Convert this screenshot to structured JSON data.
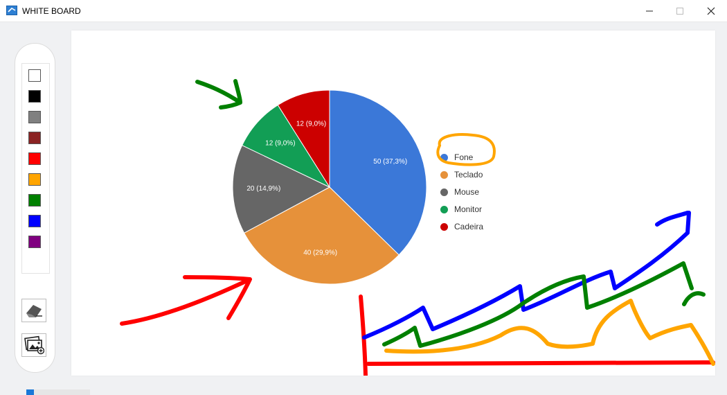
{
  "window": {
    "title": "WHITE BOARD",
    "buttons": {
      "minimize": "—",
      "maximize": "☐",
      "close": "✕"
    }
  },
  "palette": {
    "colors": [
      "#ffffff",
      "#000000",
      "#808080",
      "#8b2323",
      "#ff0000",
      "#ffa500",
      "#008000",
      "#0000ff",
      "#800080"
    ],
    "tools": [
      {
        "name": "eraser",
        "icon": "eraser-icon"
      },
      {
        "name": "insert-image",
        "icon": "image-add-icon"
      }
    ]
  },
  "chart_data": {
    "type": "pie",
    "title": "",
    "series": [
      {
        "label": "Fone",
        "value": 50,
        "percent": "37,3%",
        "color": "#3b78d8"
      },
      {
        "label": "Teclado",
        "value": 40,
        "percent": "29,9%",
        "color": "#e6913a"
      },
      {
        "label": "Mouse",
        "value": 20,
        "percent": "14,9%",
        "color": "#666666"
      },
      {
        "label": "Monitor",
        "value": 12,
        "percent": "9,0%",
        "color": "#129e55"
      },
      {
        "label": "Cadeira",
        "value": 12,
        "percent": "9,0%",
        "color": "#cc0000"
      }
    ],
    "slice_labels": [
      "50 (37,3%)",
      "40 (29,9%)",
      "20 (14,9%)",
      "12 (9,0%)",
      "12 (9,0%)"
    ],
    "legend_position": "right"
  },
  "annotations": {
    "stroke_colors": [
      "#008000",
      "#ff0000",
      "#ffa500",
      "#0000ff"
    ]
  },
  "progress": {
    "fraction": 0.12
  }
}
